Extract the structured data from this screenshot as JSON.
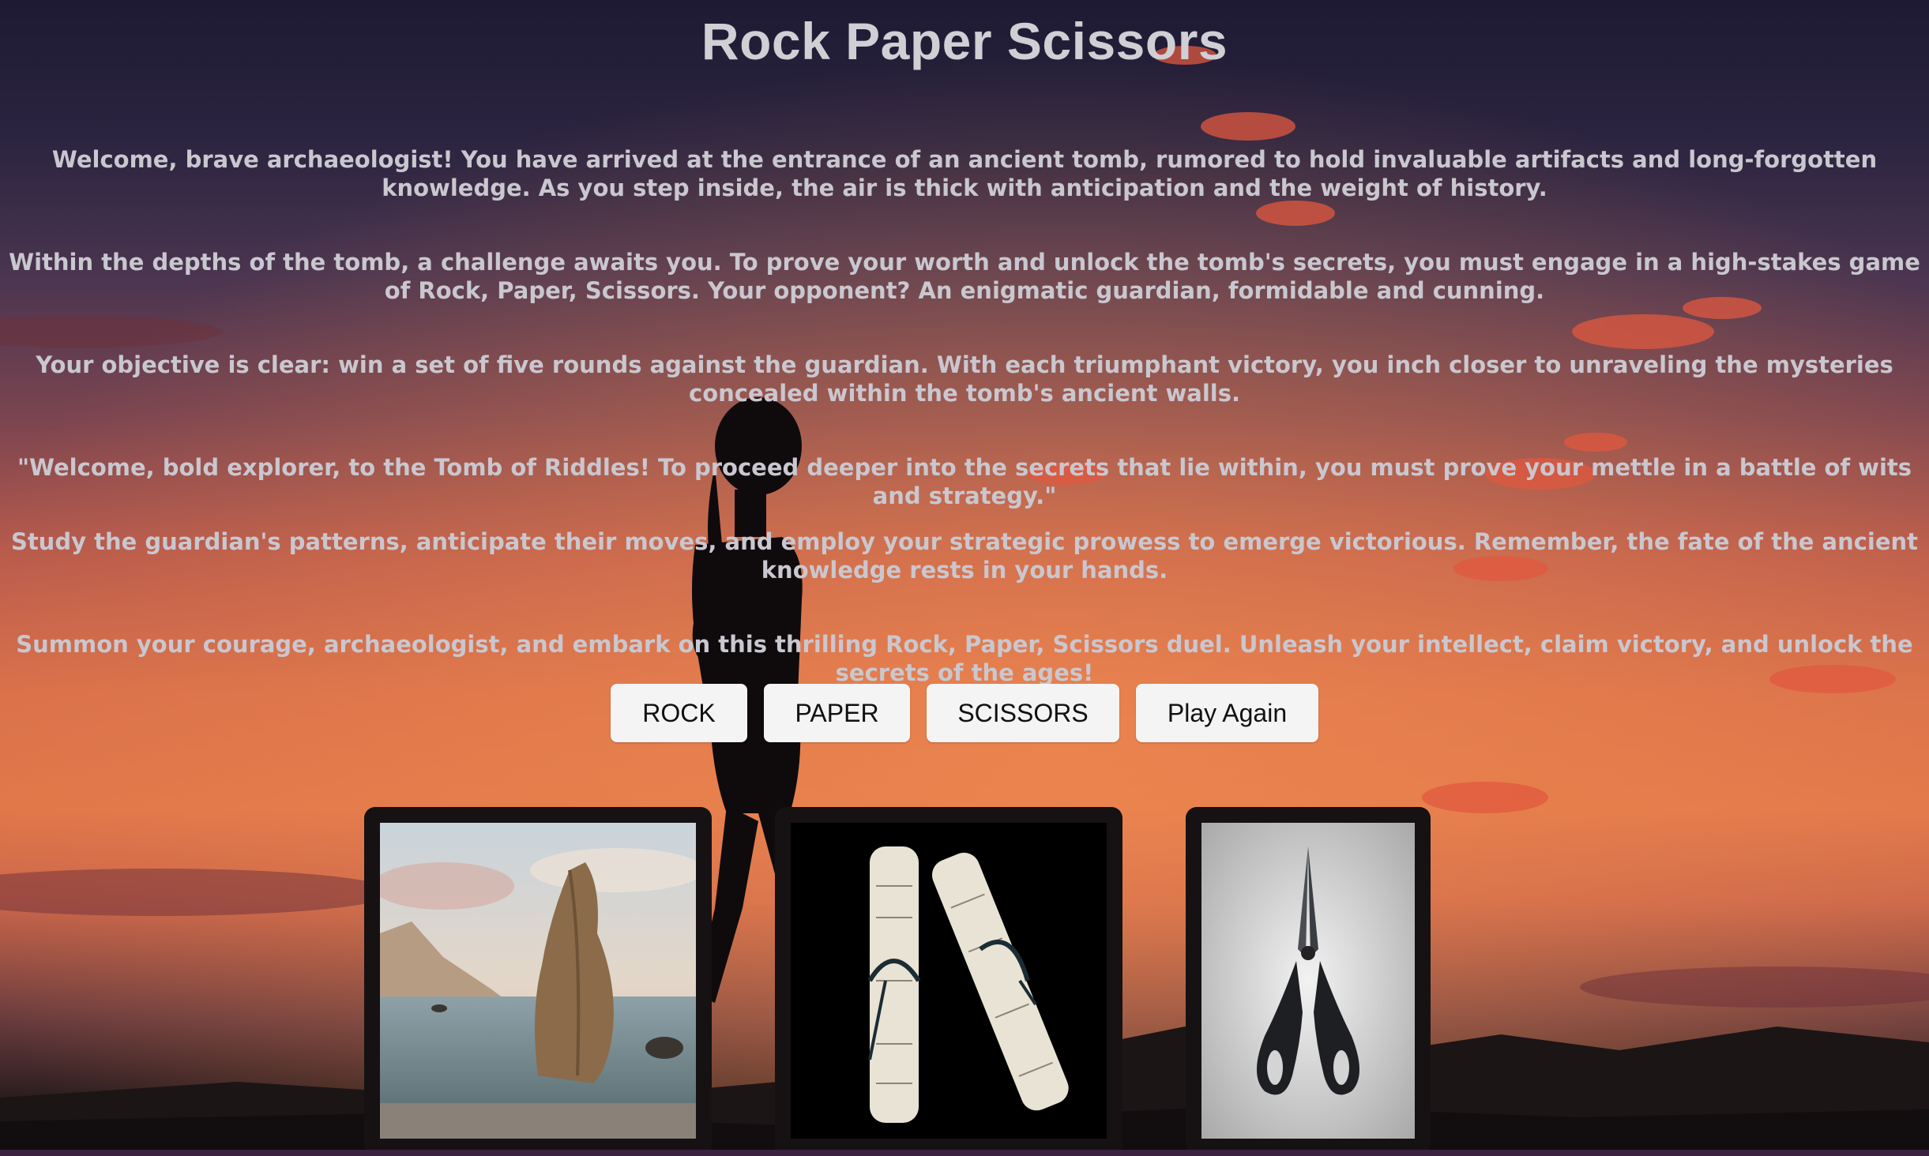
{
  "page": {
    "title": "Rock Paper Scissors",
    "paragraphs": [
      "Welcome, brave archaeologist! You have arrived at the entrance of an ancient tomb, rumored to hold invaluable artifacts and long-forgotten knowledge. As you step inside, the air is thick with anticipation and the weight of history.",
      "Within the depths of the tomb, a challenge awaits you. To prove your worth and unlock the tomb's secrets, you must engage in a high-stakes game of Rock, Paper, Scissors. Your opponent? An enigmatic guardian, formidable and cunning.",
      "Your objective is clear: win a set of five rounds against the guardian. With each triumphant victory, you inch closer to unraveling the mysteries concealed within the tomb's ancient walls.",
      "\"Welcome, bold explorer, to the Tomb of Riddles! To proceed deeper into the secrets that lie within, you must prove your mettle in a battle of wits and strategy.\"",
      "Study the guardian's patterns, anticipate their moves, and employ your strategic prowess to emerge victorious. Remember, the fate of the ancient knowledge rests in your hands.",
      "Summon your courage, archaeologist, and embark on this thrilling Rock, Paper, Scissors duel. Unleash your intellect, claim victory, and unlock the secrets of the ages!"
    ]
  },
  "buttons": {
    "rock": "ROCK",
    "paper": "PAPER",
    "scissors": "SCISSORS",
    "play_again": "Play Again"
  },
  "images": [
    {
      "icon": "rock-image"
    },
    {
      "icon": "paper-scrolls-image"
    },
    {
      "icon": "scissors-image"
    }
  ],
  "colors": {
    "title": "#cfcfd4",
    "text": "#c9c7cf",
    "button_bg": "#f4f4f4",
    "card_frame": "#161213"
  }
}
